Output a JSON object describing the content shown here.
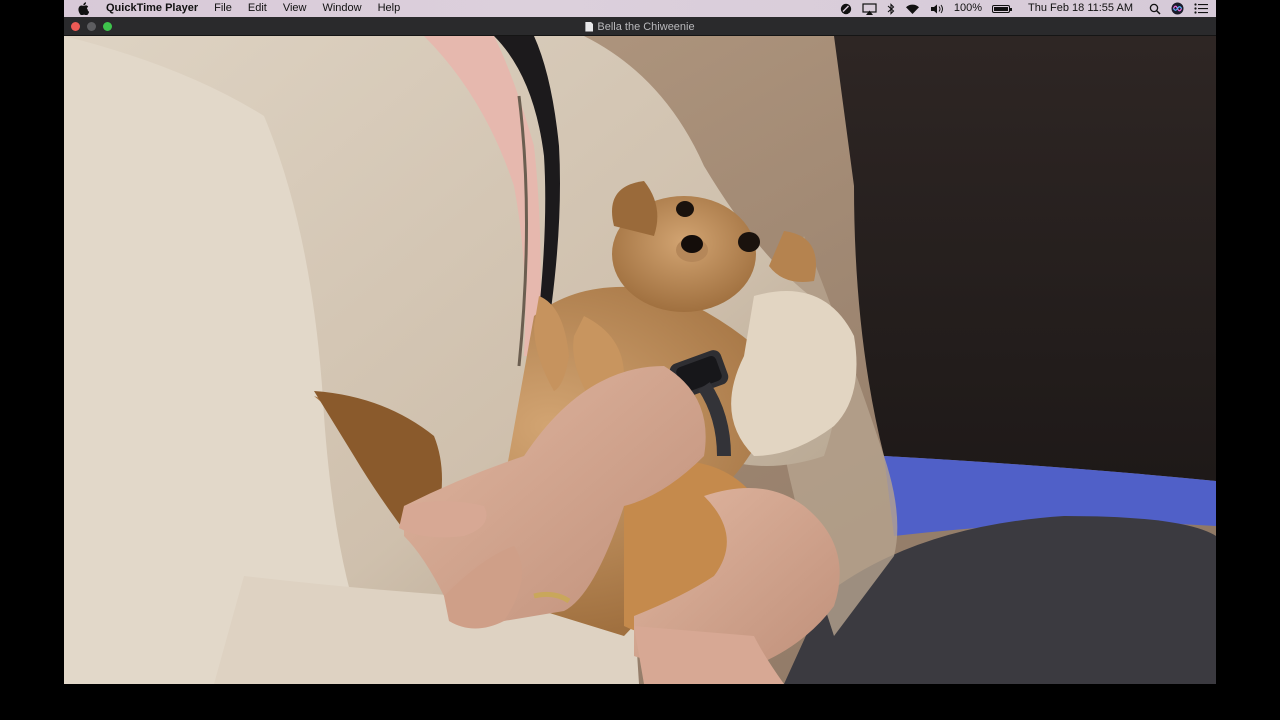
{
  "menubar": {
    "app_name": "QuickTime Player",
    "items": [
      "File",
      "Edit",
      "View",
      "Window",
      "Help"
    ],
    "status": {
      "battery_percent": "100%",
      "battery_level": 1.0,
      "datetime": "Thu Feb 18  11:55 AM"
    }
  },
  "window": {
    "title": "Bella the Chiweenie",
    "icons": {
      "close": "close-button",
      "minimize": "minimize-button",
      "zoom": "zoom-button",
      "document": "document-icon"
    }
  },
  "colors": {
    "menubar_bg": "#d8c9d8",
    "titlebar_bg": "#2a2a2c",
    "close": "#ec5b55",
    "minimize": "#5d5d60",
    "zoom": "#3ec44c"
  }
}
